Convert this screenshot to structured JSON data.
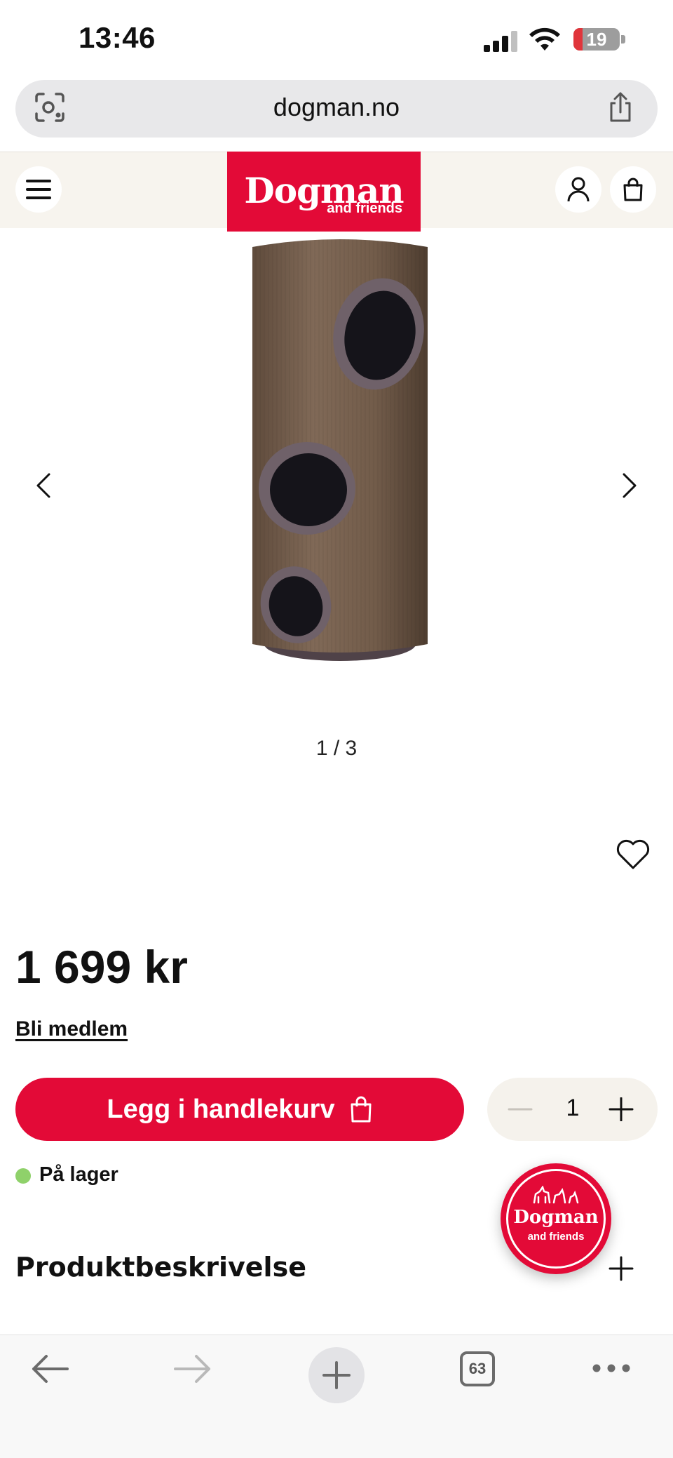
{
  "status_bar": {
    "time": "13:46",
    "battery": "19",
    "battery_level": 0.19
  },
  "browser": {
    "url": "dogman.no",
    "tab_count": "63"
  },
  "site_header": {
    "logo_main": "Dogman",
    "logo_sub": "and friends"
  },
  "gallery": {
    "counter": "1 / 3"
  },
  "product": {
    "price": "1 699 kr",
    "member_link": "Bli medlem",
    "add_to_cart": "Legg i handlekurv",
    "quantity": "1",
    "stock": "På lager",
    "section_title": "Produktbeskrivelse"
  },
  "chat_badge": {
    "main": "Dogman",
    "sub": "and friends"
  },
  "colors": {
    "brand": "#e30a37",
    "stock_ok": "#8fd16a",
    "header_bg": "#f7f4ee"
  }
}
